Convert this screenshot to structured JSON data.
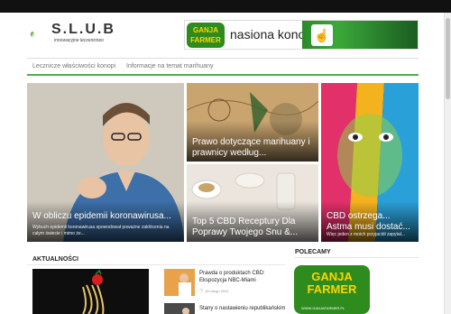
{
  "logo": {
    "name": "S.L.U.B",
    "tagline": "innowacyjne leczenictwo"
  },
  "banner": {
    "brand_line1": "GANJA",
    "brand_line2": "FARMER",
    "headline": "nasiona konopii"
  },
  "nav": {
    "items": [
      "Lecznicze właściwości konopi",
      "Informacje na temat marihuany"
    ]
  },
  "featured": [
    {
      "title": "W obliczu epidemii koronawirusa...",
      "excerpt": "Wybuch epidemii koronawirusa spowodował poważne zakłócenia na całym świecie i mimo że..."
    },
    {
      "title": "Prawo dotyczące marihuany i prawnicy według...",
      "excerpt": ""
    },
    {
      "title": "Top 5 CBD Receptury Dla Poprawy Twojego Snu &...",
      "excerpt": ""
    },
    {
      "title": "CBD ostrzega... Astma musi dostać...",
      "excerpt": "Więc jeden z moich przyjaciół zapytał..."
    }
  ],
  "sections": {
    "news_title": "AKTUALNOŚCI",
    "recommended_title": "POLECAMY"
  },
  "news": [
    {
      "title": "Prawda o produktach CBD: Ekspozycja NBC-Miami",
      "meta": "18 lutego 2022"
    },
    {
      "title": "Stany o nastawieniu republikańskim",
      "meta": ""
    }
  ],
  "ad": {
    "line1": "GANJA",
    "line2": "FARMER",
    "url": "WWW.GANJAFARMER.PL"
  },
  "colors": {
    "accent": "#4caf50",
    "topbar": "#111111"
  }
}
